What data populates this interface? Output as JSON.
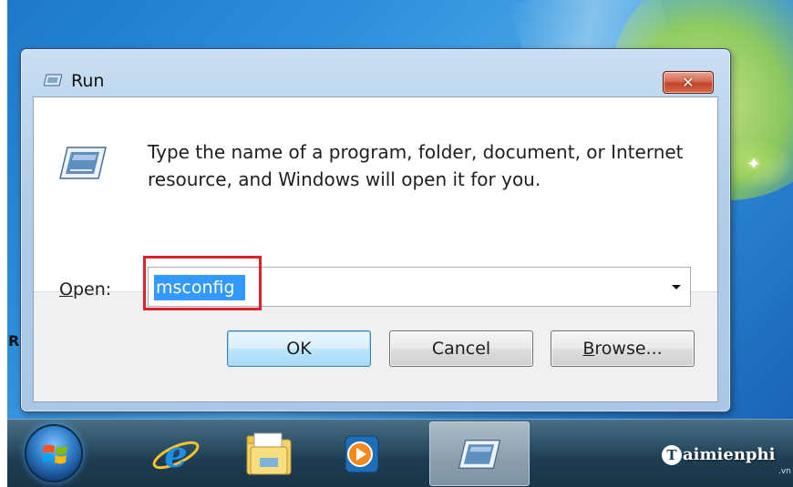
{
  "window": {
    "title": "Run",
    "close_glyph": "✕"
  },
  "dialog": {
    "description_line1": "Type the name of a program, folder, document, or Internet",
    "description_line2": "resource, and Windows will open it for you.",
    "open_label_mnemonic": "O",
    "open_label_rest": "pen:",
    "open_value": "msconfig"
  },
  "buttons": {
    "ok": "OK",
    "cancel": "Cancel",
    "browse_mnemonic": "B",
    "browse_rest": "rowse..."
  },
  "taskbar": {
    "items": [
      "start-orb",
      "internet-explorer-icon",
      "windows-explorer-icon",
      "media-player-icon",
      "run-icon"
    ],
    "active_item": "run-icon"
  },
  "watermark": {
    "brand_letter": "T",
    "brand_rest": "aimienphi",
    "brand_sub": ".vn"
  },
  "desktop": {
    "left_fragment": "R"
  },
  "colors": {
    "selection": "#3399ff",
    "highlight_box": "#d8232a",
    "close_button": "#c2452a",
    "ok_button_border": "#3c7fb1"
  }
}
